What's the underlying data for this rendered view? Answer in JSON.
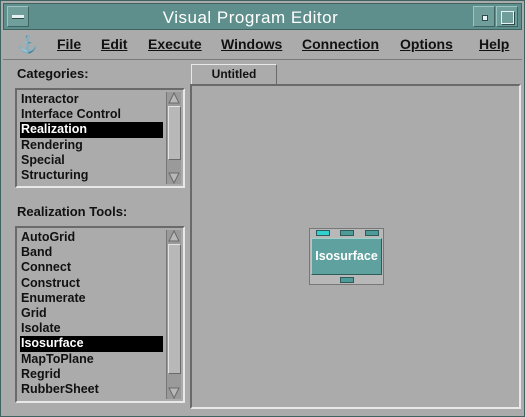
{
  "window": {
    "title": "Visual Program Editor"
  },
  "menubar": {
    "icon": "anchor-icon",
    "items": [
      {
        "label": "File"
      },
      {
        "label": "Edit"
      },
      {
        "label": "Execute"
      },
      {
        "label": "Windows"
      },
      {
        "label": "Connection"
      },
      {
        "label": "Options"
      },
      {
        "label": "Help"
      }
    ]
  },
  "categories": {
    "label": "Categories:",
    "items": [
      "Interactor",
      "Interface Control",
      "Realization",
      "Rendering",
      "Special",
      "Structuring"
    ],
    "selected": "Realization"
  },
  "tools": {
    "label": "Realization Tools:",
    "items": [
      "AutoGrid",
      "Band",
      "Connect",
      "Construct",
      "Enumerate",
      "Grid",
      "Isolate",
      "Isosurface",
      "MapToPlane",
      "Regrid",
      "RubberSheet"
    ],
    "selected": "Isosurface"
  },
  "canvas": {
    "tab": "Untitled",
    "module": {
      "label": "Isosurface"
    }
  },
  "colors": {
    "title_bar": "#5f8f8c",
    "module": "#5ea19e",
    "selected_port": "#33d0d0"
  }
}
